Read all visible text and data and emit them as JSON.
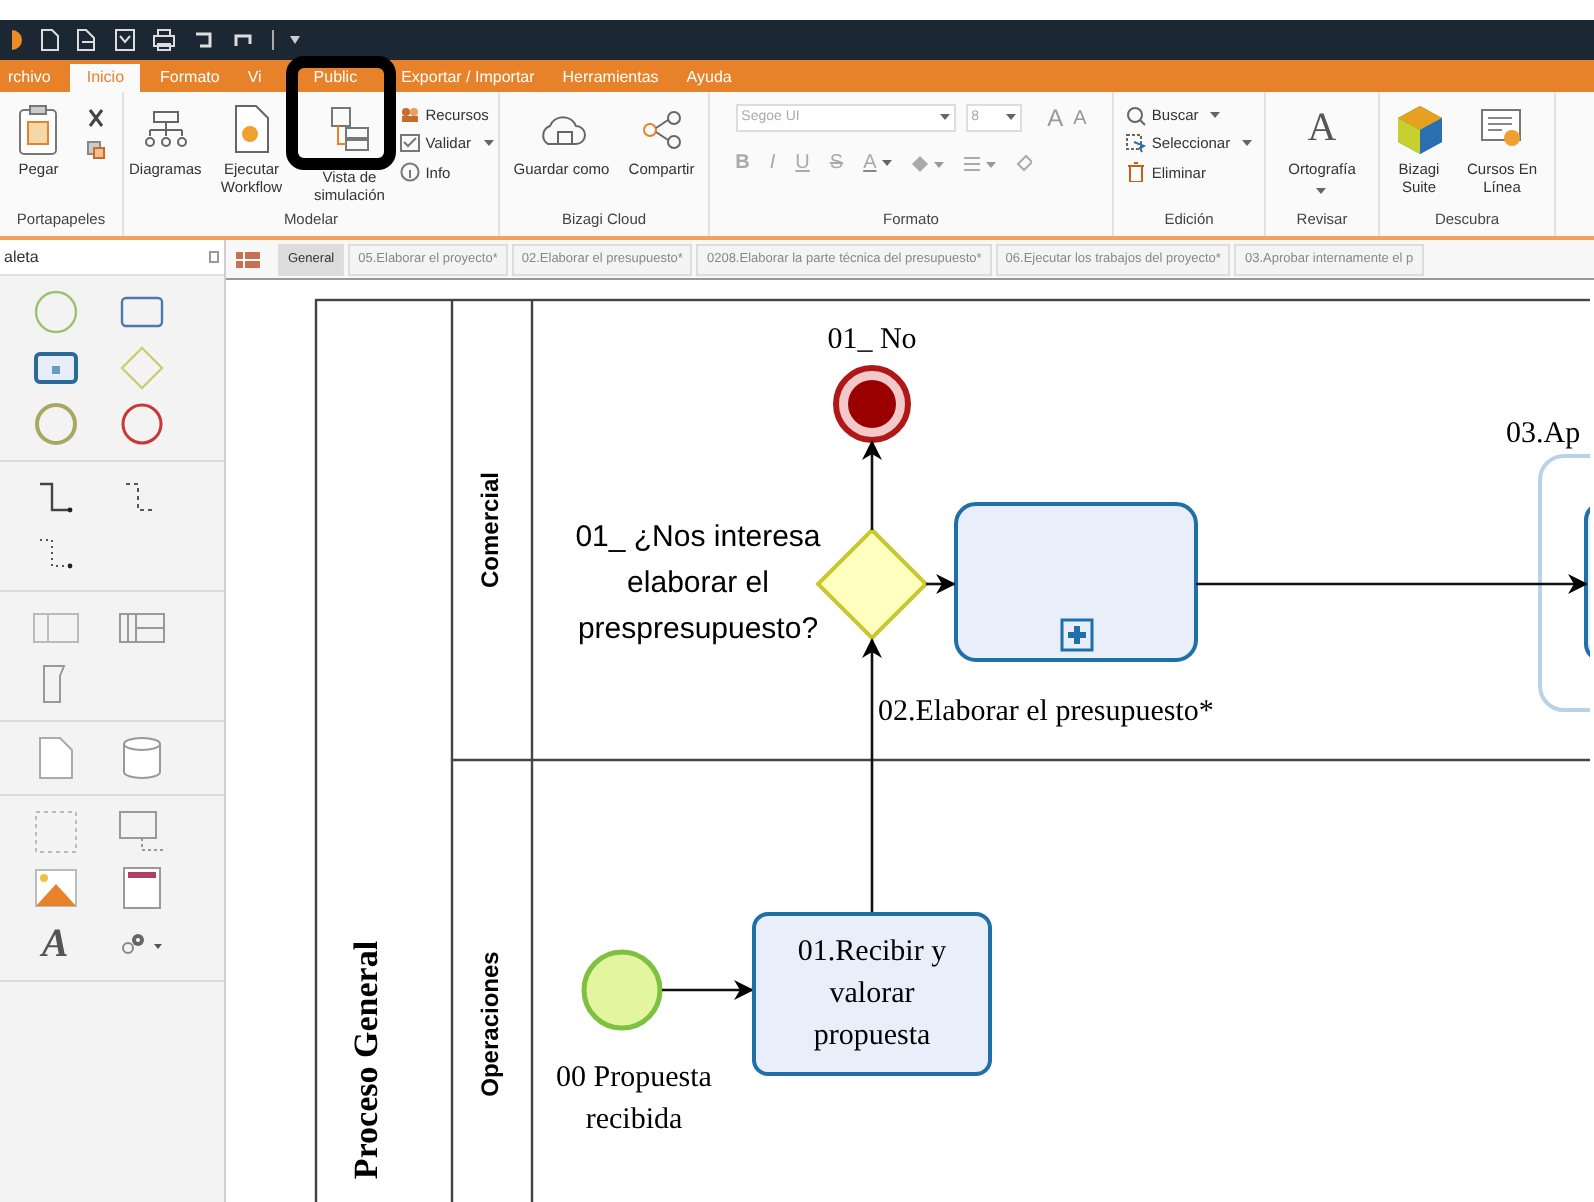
{
  "menu_tabs": [
    {
      "label": "rchivo",
      "selected": false
    },
    {
      "label": "Inicio",
      "selected": true
    },
    {
      "label": "Formato",
      "selected": false
    },
    {
      "label": "Vi",
      "selected": false
    },
    {
      "label": "Public",
      "selected": false
    },
    {
      "label": "Exportar / Importar",
      "selected": false
    },
    {
      "label": "Herramientas",
      "selected": false
    },
    {
      "label": "Ayuda",
      "selected": false
    }
  ],
  "ribbon_groups": [
    {
      "title": "Portapapeles",
      "items": [
        {
          "kind": "large",
          "label": "Pegar"
        },
        {
          "kind": "mini"
        }
      ]
    },
    {
      "title": "Modelar",
      "items": [
        {
          "kind": "large",
          "label": "Diagramas"
        },
        {
          "kind": "large",
          "label": "Ejecutar Workflow"
        },
        {
          "kind": "large",
          "label": "Vista de simulación"
        },
        {
          "kind": "stack",
          "entries": [
            {
              "label": "Recursos",
              "dropdown": false
            },
            {
              "label": "Validar",
              "dropdown": true
            },
            {
              "label": "Info",
              "dropdown": false
            }
          ]
        }
      ]
    },
    {
      "title": "Bizagi Cloud",
      "items": [
        {
          "kind": "large",
          "label": "Guardar como"
        },
        {
          "kind": "large",
          "label": "Compartir"
        }
      ]
    },
    {
      "title": "Formato",
      "items": [
        {
          "kind": "font",
          "font": "Segoe UI",
          "size": "8",
          "size_buttons": [
            "A",
            "A"
          ],
          "style_buttons": [
            "B",
            "I",
            "U",
            "S"
          ],
          "color_letter": "A"
        }
      ]
    },
    {
      "title": "Edición",
      "items": [
        {
          "kind": "stack",
          "entries": [
            {
              "label": "Buscar",
              "dropdown": true
            },
            {
              "label": "Seleccionar",
              "dropdown": true
            },
            {
              "label": "Eliminar",
              "dropdown": false
            }
          ]
        }
      ]
    },
    {
      "title": "Revisar",
      "items": [
        {
          "kind": "large",
          "label": "Ortografía",
          "icon_letter": "A",
          "dropdown": true
        }
      ]
    },
    {
      "title": "Descubra",
      "items": [
        {
          "kind": "large",
          "label": "Bizagi Suite"
        },
        {
          "kind": "large",
          "label": "Cursos En Línea"
        }
      ]
    }
  ],
  "palette": {
    "title": "aleta",
    "text_tool": "A"
  },
  "doc_tabs": [
    {
      "label": "General",
      "selected": true
    },
    {
      "label": "05.Elaborar el proyecto*",
      "selected": false
    },
    {
      "label": "02.Elaborar el presupuesto*",
      "selected": false
    },
    {
      "label": "0208.Elaborar la parte técnica del presupuesto*",
      "selected": false
    },
    {
      "label": "06.Ejecutar los trabajos del proyecto*",
      "selected": false
    },
    {
      "label": "03.Aprobar internamente el p",
      "selected": false
    }
  ],
  "diagram": {
    "pool": "Proceso General",
    "lanes": [
      {
        "name": "Comercial"
      },
      {
        "name": "Operaciones"
      }
    ],
    "elements": [
      {
        "kind": "end_event",
        "label": "01_ No"
      },
      {
        "kind": "gateway",
        "label": "01_ ¿Nos interesa elaborar el prespresupuesto?"
      },
      {
        "kind": "subprocess",
        "label": "02.Elaborar el presupuesto*"
      },
      {
        "kind": "task_partial",
        "label": "03.Ap"
      },
      {
        "kind": "start_event",
        "label": "00 Propuesta recibida"
      },
      {
        "kind": "task",
        "label": "01.Recibir y valorar propuesta"
      }
    ]
  }
}
